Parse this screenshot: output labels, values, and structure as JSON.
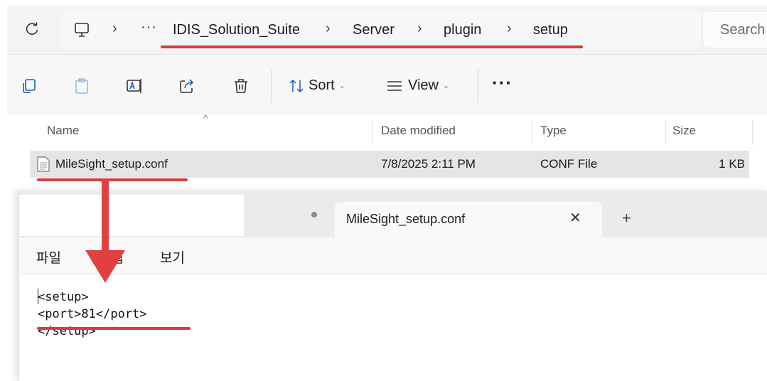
{
  "address_bar": {
    "refresh_icon": "refresh-icon",
    "pc_icon": "monitor-icon",
    "overflow": "···",
    "separator": "›",
    "crumbs": [
      "IDIS_Solution_Suite",
      "Server",
      "plugin",
      "setup"
    ],
    "search_label": "Search"
  },
  "toolbar": {
    "icons": [
      "copy-icon",
      "paste-icon",
      "rename-icon",
      "share-icon",
      "delete-icon"
    ],
    "sort_label": "Sort",
    "view_label": "View",
    "more_label": "···"
  },
  "file_list": {
    "columns": [
      "Name",
      "Date modified",
      "Type",
      "Size"
    ],
    "sort_indicator": "^",
    "rows": [
      {
        "name": "MileSight_setup.conf",
        "date": "7/8/2025 2:11 PM",
        "type": "CONF File",
        "size": "1 KB"
      }
    ]
  },
  "notepad": {
    "tab_title": "MileSight_setup.conf",
    "tab_close": "✕",
    "new_tab": "+",
    "menu": [
      "파일",
      "편집",
      "보기"
    ],
    "content_lines": [
      "<setup>",
      "<port>81</port>",
      "</setup>"
    ]
  },
  "annotation_color": "#e0413f"
}
